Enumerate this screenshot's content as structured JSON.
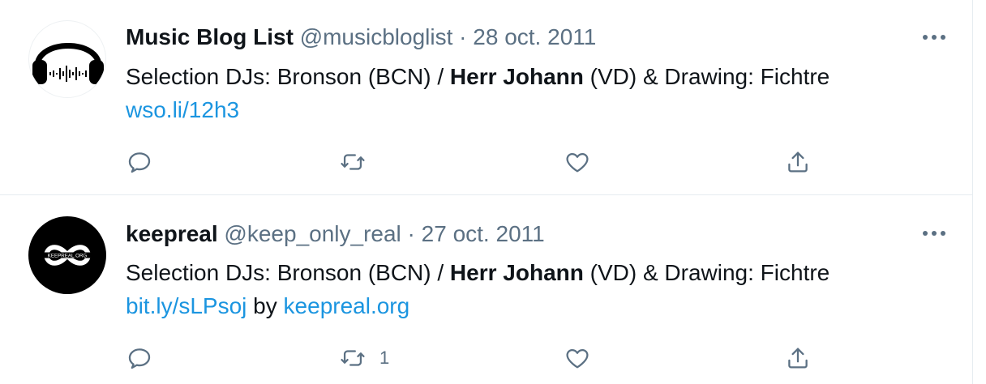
{
  "tweets": [
    {
      "author_name": "Music Blog List",
      "handle": "@musicbloglist",
      "separator": "·",
      "date": "28 oct. 2011",
      "text_prefix": "Selection DJs: Bronson (BCN) / ",
      "text_bold": "Herr Johann",
      "text_suffix": " (VD) & Drawing: Fichtre",
      "link1": "wso.li/12h3",
      "connector": "",
      "link2": "",
      "retweet_count": "",
      "avatar_icon": "headphones-icon"
    },
    {
      "author_name": "keepreal",
      "handle": "@keep_only_real",
      "separator": "·",
      "date": "27 oct. 2011",
      "text_prefix": "Selection DJs: Bronson (BCN) / ",
      "text_bold": "Herr Johann",
      "text_suffix": " (VD) & Drawing: Fichtre",
      "link1": "bit.ly/sLPsoj",
      "connector": " by ",
      "link2": "keepreal.org",
      "retweet_count": "1",
      "avatar_icon": "infinity-icon",
      "avatar_text": "KEEPREAL.ORG"
    }
  ],
  "colors": {
    "link": "#1b95e0",
    "secondary": "#5b7083",
    "border": "#e6ecf0"
  },
  "icons": [
    "reply-icon",
    "retweet-icon",
    "like-icon",
    "share-icon",
    "more-icon"
  ]
}
